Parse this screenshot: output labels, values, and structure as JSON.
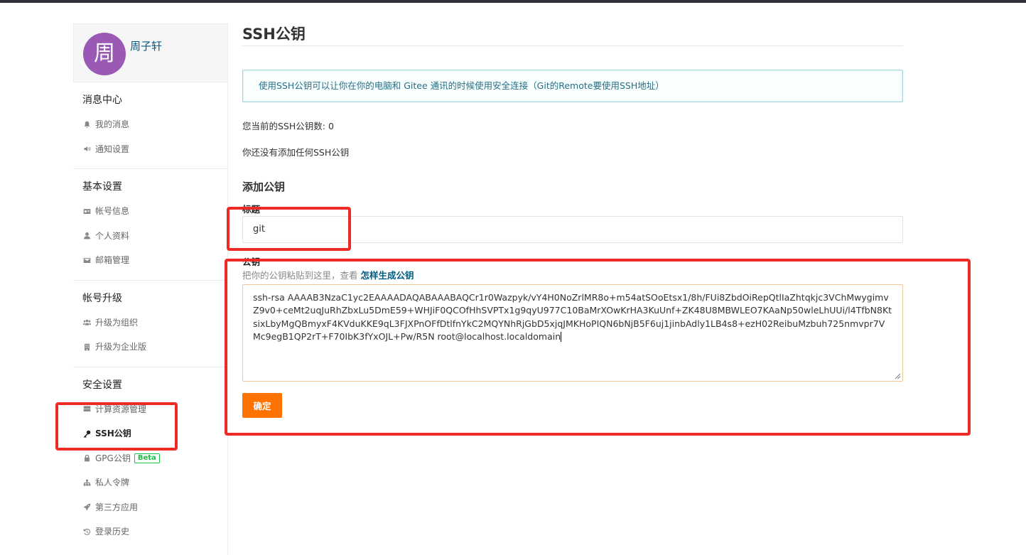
{
  "user": {
    "avatar_char": "周",
    "name": "周子轩",
    "avatar_color": "#9b59b6"
  },
  "sidebar": {
    "sections": [
      {
        "title": "消息中心",
        "items": [
          {
            "label": "我的消息",
            "icon": "bell-icon"
          },
          {
            "label": "通知设置",
            "icon": "speaker-icon"
          }
        ]
      },
      {
        "title": "基本设置",
        "items": [
          {
            "label": "帐号信息",
            "icon": "id-card-icon"
          },
          {
            "label": "个人资料",
            "icon": "user-icon"
          },
          {
            "label": "邮箱管理",
            "icon": "mail-icon"
          }
        ]
      },
      {
        "title": "帐号升级",
        "items": [
          {
            "label": "升级为组织",
            "icon": "users-icon"
          },
          {
            "label": "升级为企业版",
            "icon": "building-icon"
          }
        ]
      },
      {
        "title": "安全设置",
        "items": [
          {
            "label": "计算资源管理",
            "icon": "server-icon"
          },
          {
            "label": "SSH公钥",
            "icon": "key-icon",
            "active": true
          },
          {
            "label": "GPG公钥",
            "icon": "lock-icon",
            "badge": "Beta"
          },
          {
            "label": "私人令牌",
            "icon": "sitemap-icon"
          },
          {
            "label": "第三方应用",
            "icon": "rocket-icon"
          },
          {
            "label": "登录历史",
            "icon": "history-icon"
          }
        ]
      }
    ]
  },
  "main": {
    "page_title": "SSH公钥",
    "info_text": "使用SSH公钥可以让你在你的电脑和 Gitee 通讯的时候使用安全连接（Git的Remote要使用SSH地址）",
    "count_text": "您当前的SSH公钥数: 0",
    "none_text": "你还没有添加任何SSH公钥",
    "add_title": "添加公钥",
    "title_label": "标题",
    "title_value": "git",
    "key_label": "公钥",
    "key_hint": "把你的公钥粘贴到这里，查看",
    "key_hint_link": "怎样生成公钥",
    "key_value": "ssh-rsa AAAAB3NzaC1yc2EAAAADAQABAAABAQCr1r0Wazpyk/vY4H0NoZrlMR8o+m54atSOoEtsx1/8h/FUi8ZbdOiRepQtlIaZhtqkjc3VChMwygimvZ9v0+ceMt2uqJuRhZbxLu5DmE59+WHJiF0QCOfHhSVPTx1g9qyU977C10BaMrXOwKrHA3KuUnf+ZK48U8MBWLEO7KAaNp50wleLhUUi/l4TfbN8KtsixLbyMgQBmyxF4KVduKKE9qL3FJXPnOFfDtlfnYkC2MQYNhRjGbD5xjqJMKHoPIQN6bNjB5F6uj1jinbAdly1LB4s8+ezH02ReibuMzbuh725nmvpr7VMc9egB1QP2rT+F70IbK3fYxOJL+Pw/R5N root@localhost.localdomain",
    "submit_label": "确定",
    "accent_color": "#fe7300"
  }
}
